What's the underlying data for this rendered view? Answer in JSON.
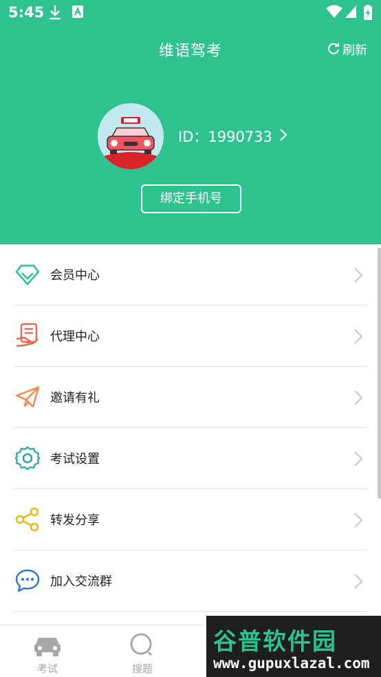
{
  "status_bar": {
    "time": "5:45"
  },
  "header": {
    "title": "维语驾考",
    "refresh_label": "刷新",
    "user_id": "ID：1990733",
    "bind_phone_label": "绑定手机号"
  },
  "menu": {
    "items": [
      {
        "label": "会员中心",
        "icon": "diamond-icon",
        "color": "#2ec28e"
      },
      {
        "label": "代理中心",
        "icon": "agent-icon",
        "color": "#e8664a"
      },
      {
        "label": "邀请有礼",
        "icon": "paper-plane-icon",
        "color": "#f0894a"
      },
      {
        "label": "考试设置",
        "icon": "gear-icon",
        "color": "#27a7a0"
      },
      {
        "label": "转发分享",
        "icon": "share-icon",
        "color": "#f3b71b"
      },
      {
        "label": "加入交流群",
        "icon": "chat-icon",
        "color": "#2f74c8"
      }
    ]
  },
  "tabbar": {
    "tabs": [
      {
        "label": "考试",
        "icon": "car-icon"
      },
      {
        "label": "搜题",
        "icon": "search-icon"
      }
    ]
  },
  "watermark": {
    "title": "谷普软件园",
    "url": "www.gupuxlazal.com"
  },
  "colors": {
    "primary": "#2ec28e",
    "tab_inactive": "#a8a8a8"
  }
}
